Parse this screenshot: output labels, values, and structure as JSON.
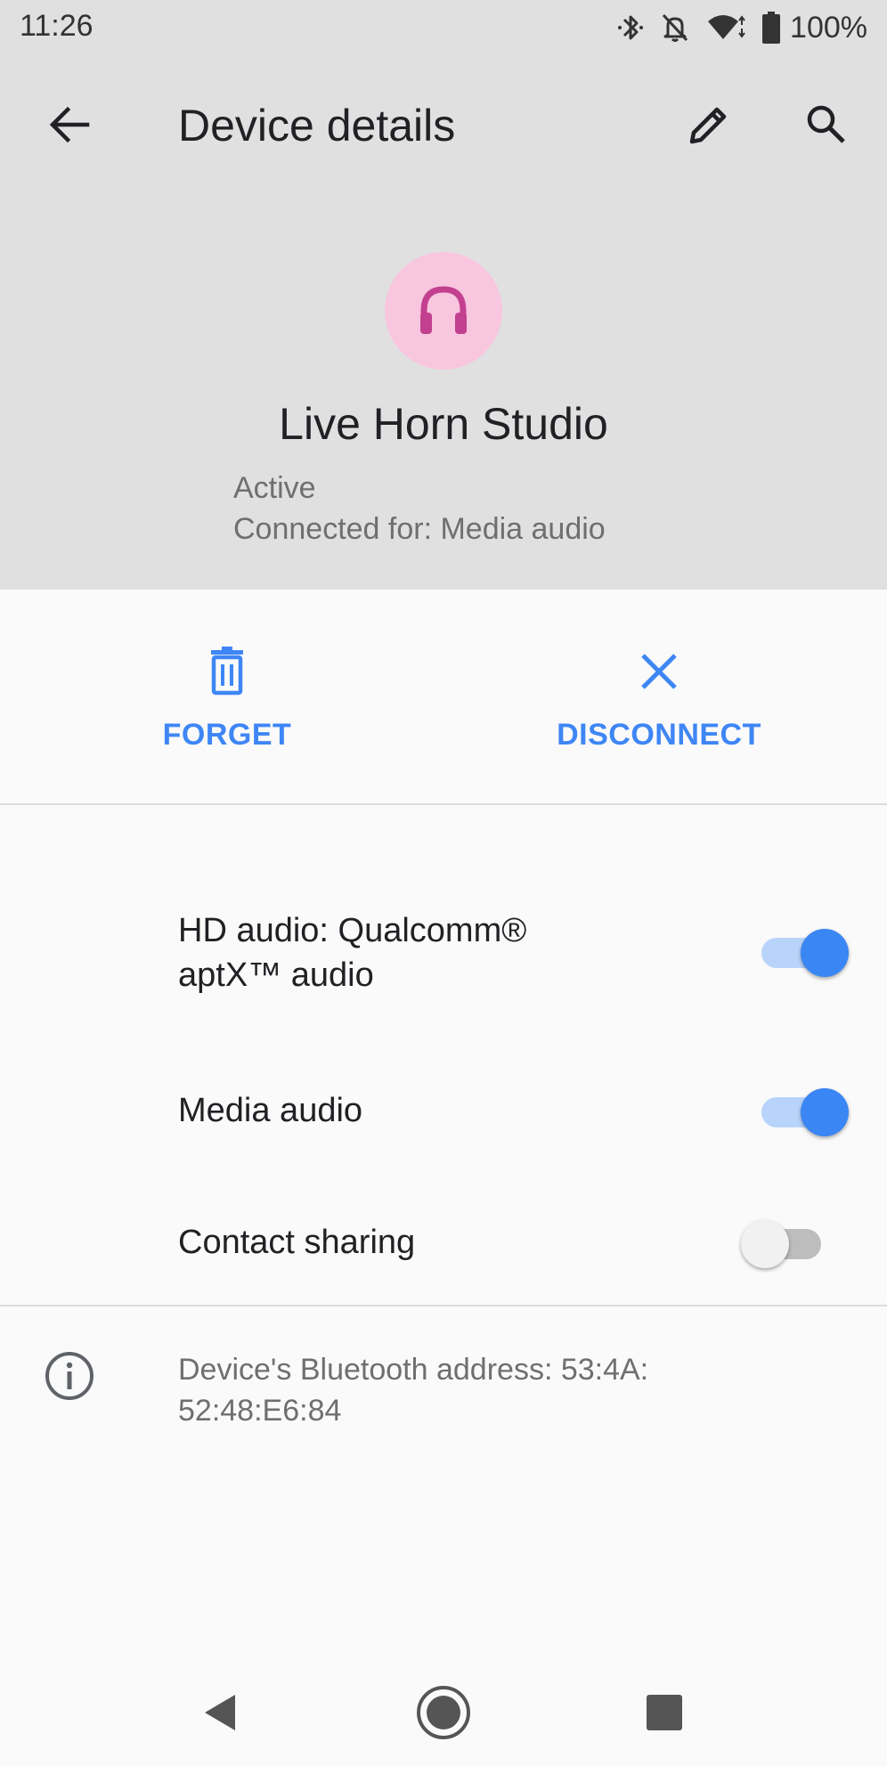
{
  "status_bar": {
    "time": "11:26",
    "battery": "100%",
    "icons": [
      "bluetooth-icon",
      "notifications-off-icon",
      "wifi-icon",
      "battery-icon"
    ]
  },
  "header": {
    "title": "Device details",
    "icons": [
      "back-arrow-icon",
      "edit-pencil-icon",
      "search-icon"
    ]
  },
  "device": {
    "name": "Live Horn Studio",
    "status": "Active",
    "connected_for": "Connected for: Media audio",
    "icon": "headphones-icon",
    "icon_bg_color": "#f8c6df",
    "icon_color": "#c2408f"
  },
  "actions": {
    "forget": "FORGET",
    "disconnect": "DISCONNECT",
    "accent_color": "#3f86f5"
  },
  "settings": {
    "hd_audio_line1": "HD audio: Qualcomm®",
    "hd_audio_line2": "aptX™ audio",
    "hd_audio_enabled": true,
    "media_audio": "Media audio",
    "media_audio_enabled": true,
    "contact_sharing": "Contact sharing",
    "contact_sharing_enabled": false
  },
  "info": {
    "address_line1": "Device's Bluetooth address: 53:4A:",
    "address_line2": "52:48:E6:84"
  },
  "nav": {
    "icons": [
      "nav-back-icon",
      "nav-home-icon",
      "nav-recents-icon"
    ]
  }
}
